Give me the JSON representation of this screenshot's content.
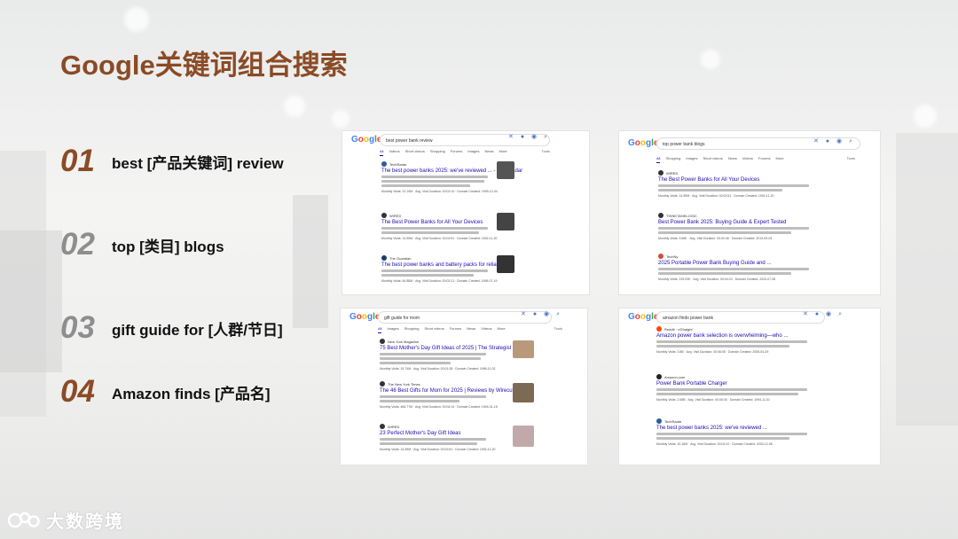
{
  "slide": {
    "title": "Google关键词组合搜索",
    "items": [
      {
        "number": "01",
        "label": "best [产品关键词] review"
      },
      {
        "number": "02",
        "label": "top [类目] blogs"
      },
      {
        "number": "03",
        "label": "gift guide for [人群/节日]"
      },
      {
        "number": "04",
        "label": "Amazon finds [产品名]"
      }
    ],
    "watermark": "大数跨境"
  },
  "colors": {
    "accent": "#8a4b25",
    "number_gray": "#8e8e8e",
    "link": "#1a0dab"
  },
  "screenshots": [
    {
      "query": "best power bank review",
      "tabs": [
        "All",
        "Videos",
        "Short videos",
        "Shopping",
        "Forums",
        "Images",
        "News",
        "More"
      ],
      "tools": "Tools",
      "results": [
        {
          "site": "TechRadar",
          "title": "The best power banks 2025: we've reviewed ... - TechRadar",
          "meta": "Monthly Visits: 21.19M · Avg. Visit Duration: 00:02:10 · Domain Created: 1999-12-04"
        },
        {
          "site": "WIRED",
          "title": "The Best Power Banks for All Your Devices",
          "meta": "Monthly Visits: 14.59M · Avg. Visit Duration: 00:02:51 · Domain Created: 1992-11-20"
        },
        {
          "site": "The Guardian",
          "title": "The best power banks and battery packs for reliable ...",
          "meta": "Monthly Visits: 64.88M · Avg. Visit Duration: 00:02:11 · Domain Created: 1995-07-19"
        }
      ]
    },
    {
      "query": "top power bank blogs",
      "tabs": [
        "All",
        "Shopping",
        "Images",
        "Short videos",
        "News",
        "Videos",
        "Forums",
        "More"
      ],
      "tools": "Tools",
      "results": [
        {
          "site": "WIRED",
          "title": "The Best Power Banks for All Your Devices",
          "meta": "Monthly Visits: 14.59M · Avg. Visit Duration: 00:02:51 · Domain Created: 1992-11-20"
        },
        {
          "site": "THINKTANKLOGIC",
          "title": "Best Power Bank 2025: Buying Guide & Expert Tested",
          "meta": "Monthly Visits: 9.56K · Avg. Visit Duration: 00:02:46 · Domain Created: 2013-09-03"
        },
        {
          "site": "TechNy",
          "title": "2025 Portable Power Bank Buying Guide and ...",
          "meta": "Monthly Visits: 215.93K · Avg. Visit Duration: 00:04:24 · Domain Created: 2020-07-28"
        }
      ]
    },
    {
      "query": "gift guide for mom",
      "tabs": [
        "All",
        "Images",
        "Shopping",
        "Short videos",
        "Forums",
        "News",
        "Videos",
        "More"
      ],
      "tools": "Tools",
      "results": [
        {
          "site": "New York Magazine",
          "title": "75 Best Mother's Day Gift Ideas of 2025 | The Strategist",
          "meta": "Monthly Visits: 15.74M · Avg. Visit Duration: 00:01:38 · Domain Created: 1996-11-02"
        },
        {
          "site": "The New York Times",
          "title": "The 46 Best Gifts for Mom for 2025 | Reviews by Wirecutter",
          "meta": "Monthly Visits: 466.77M · Avg. Visit Duration: 00:04:14 · Domain Created: 1994-01-18"
        },
        {
          "site": "WIRED",
          "title": "23 Perfect Mother's Day Gift Ideas",
          "meta": "Monthly Visits: 14.59M · Avg. Visit Duration: 00:02:51 · Domain Created: 1992-11-20"
        }
      ]
    },
    {
      "query": "amazon finds power bank",
      "tabs": [],
      "tools": "",
      "results": [
        {
          "site": "Reddit · r/Ghaight",
          "title": "Amazon power bank selection is overwhelming—who ...",
          "meta": "Monthly Visits: 3.8B · Avg. Visit Duration: 00:06:05 · Domain Created: 2005-04-29"
        },
        {
          "site": "Amazon.com",
          "title": "Power Bank Portable Charger",
          "meta": "Monthly Visits: 2.55B · Avg. Visit Duration: 00:06:30 · Domain Created: 1994-11-01"
        },
        {
          "site": "TechRadar",
          "title": "The best power banks 2025: we've reviewed ...",
          "meta": "Monthly Visits: 20.18M · Avg. Visit Duration: 00:02:10 · Domain Created: 2003-12-06"
        }
      ]
    }
  ]
}
